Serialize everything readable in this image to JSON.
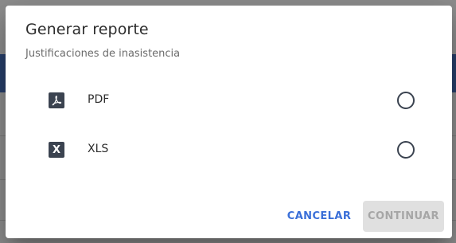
{
  "dialog": {
    "title": "Generar reporte",
    "subtitle": "Justificaciones de inasistencia",
    "options": [
      {
        "label": "PDF",
        "icon": "pdf-icon",
        "icon_glyph": "⅄",
        "selected": false
      },
      {
        "label": "XLS",
        "icon": "excel-icon",
        "icon_glyph": "X",
        "selected": false
      }
    ],
    "cancel_label": "CANCELAR",
    "continue_label": "CONTINUAR",
    "continue_enabled": false
  },
  "colors": {
    "accent": "#3a6fd8",
    "icon_bg": "#3b4350",
    "disabled_bg": "#e0e0e0",
    "disabled_text": "#a6a6a6"
  }
}
